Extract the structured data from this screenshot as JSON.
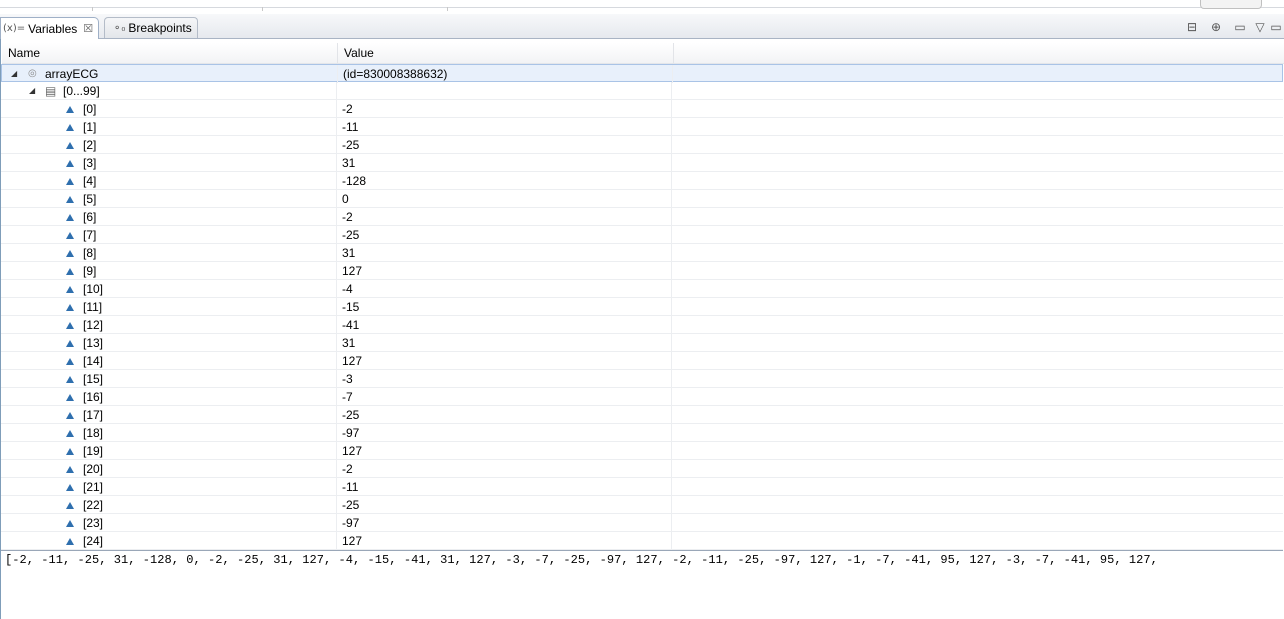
{
  "tabs": [
    {
      "label": "Variables",
      "icon": "(x)=",
      "active": true
    },
    {
      "label": "Breakpoints",
      "icon": "°",
      "active": false
    }
  ],
  "columns": {
    "name": "Name",
    "value": "Value"
  },
  "root": {
    "name": "arrayECG",
    "value": "(id=830008388632)"
  },
  "group": {
    "name": "[0...99]"
  },
  "elements": [
    {
      "name": "[0]",
      "value": "-2"
    },
    {
      "name": "[1]",
      "value": "-11"
    },
    {
      "name": "[2]",
      "value": "-25"
    },
    {
      "name": "[3]",
      "value": "31"
    },
    {
      "name": "[4]",
      "value": "-128"
    },
    {
      "name": "[5]",
      "value": "0"
    },
    {
      "name": "[6]",
      "value": "-2"
    },
    {
      "name": "[7]",
      "value": "-25"
    },
    {
      "name": "[8]",
      "value": "31"
    },
    {
      "name": "[9]",
      "value": "127"
    },
    {
      "name": "[10]",
      "value": "-4"
    },
    {
      "name": "[11]",
      "value": "-15"
    },
    {
      "name": "[12]",
      "value": "-41"
    },
    {
      "name": "[13]",
      "value": "31"
    },
    {
      "name": "[14]",
      "value": "127"
    },
    {
      "name": "[15]",
      "value": "-3"
    },
    {
      "name": "[16]",
      "value": "-7"
    },
    {
      "name": "[17]",
      "value": "-25"
    },
    {
      "name": "[18]",
      "value": "-97"
    },
    {
      "name": "[19]",
      "value": "127"
    },
    {
      "name": "[20]",
      "value": "-2"
    },
    {
      "name": "[21]",
      "value": "-11"
    },
    {
      "name": "[22]",
      "value": "-25"
    },
    {
      "name": "[23]",
      "value": "-97"
    },
    {
      "name": "[24]",
      "value": "127"
    }
  ],
  "detail_text": "[-2, -11, -25, 31, -128, 0, -2, -25, 31, 127, -4, -15, -41, 31, 127, -3, -7, -25, -97, 127, -2, -11, -25, -97, 127, -1, -7, -41, 95, 127, -3, -7, -41, 95, 127,",
  "toolbar_icons": [
    "collapse-all-icon",
    "show-type-names-icon",
    "minimize-icon",
    "view-menu-icon",
    "maximize-icon"
  ]
}
